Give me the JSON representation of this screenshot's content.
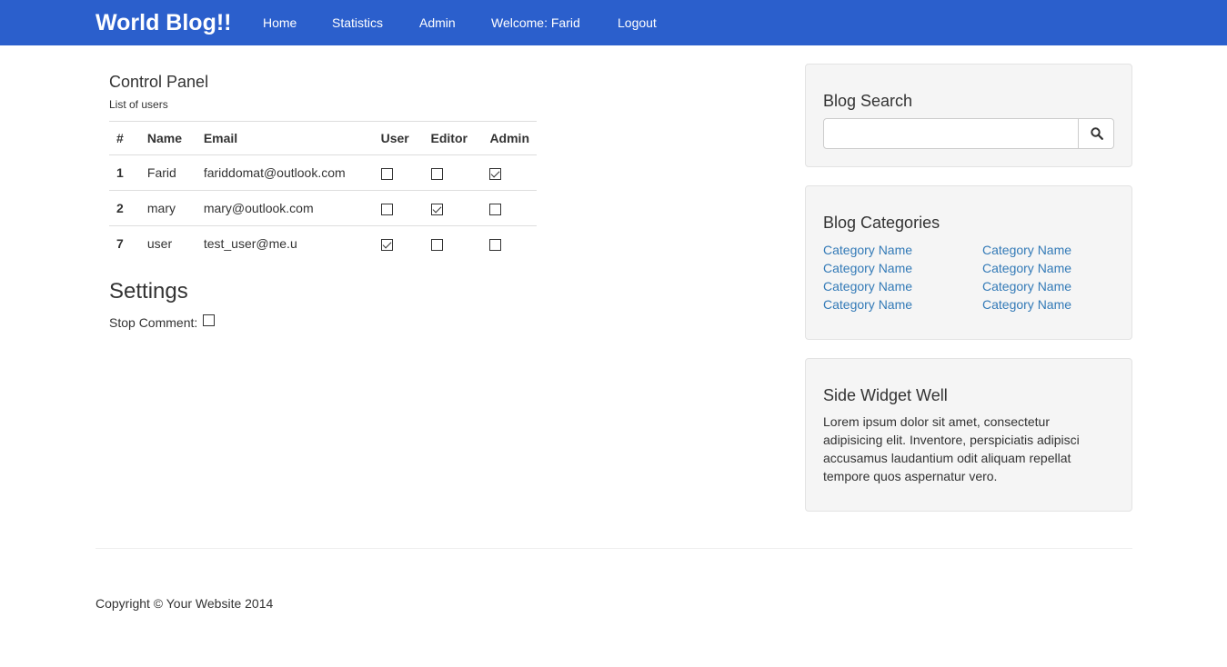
{
  "navbar": {
    "brand": "World Blog!!",
    "links": [
      "Home",
      "Statistics",
      "Admin",
      "Welcome: Farid",
      "Logout"
    ]
  },
  "control_panel": {
    "title": "Control Panel",
    "subtitle": "List of users",
    "headers": [
      "#",
      "Name",
      "Email",
      "User",
      "Editor",
      "Admin"
    ],
    "rows": [
      {
        "id": "1",
        "name": "Farid",
        "email": "fariddomat@outlook.com",
        "user": false,
        "editor": false,
        "admin": true
      },
      {
        "id": "2",
        "name": "mary",
        "email": "mary@outlook.com",
        "user": false,
        "editor": true,
        "admin": false
      },
      {
        "id": "7",
        "name": "user",
        "email": "test_user@me.u",
        "user": true,
        "editor": false,
        "admin": false
      }
    ]
  },
  "settings": {
    "title": "Settings",
    "stop_comment_label": "Stop Comment:",
    "stop_comment_checked": false
  },
  "sidebar": {
    "search": {
      "title": "Blog Search",
      "value": "",
      "icon": "search-icon"
    },
    "categories": {
      "title": "Blog Categories",
      "left": [
        "Category Name",
        "Category Name",
        "Category Name",
        "Category Name"
      ],
      "right": [
        "Category Name",
        "Category Name",
        "Category Name",
        "Category Name"
      ]
    },
    "widget": {
      "title": "Side Widget Well",
      "text": "Lorem ipsum dolor sit amet, consectetur adipisicing elit. Inventore, perspiciatis adipisci accusamus laudantium odit aliquam repellat tempore quos aspernatur vero."
    }
  },
  "footer": {
    "copyright": "Copyright © Your Website 2014"
  },
  "colors": {
    "navbar": "#2b5fcc",
    "link": "#337ab7",
    "well_bg": "#f5f5f5"
  }
}
